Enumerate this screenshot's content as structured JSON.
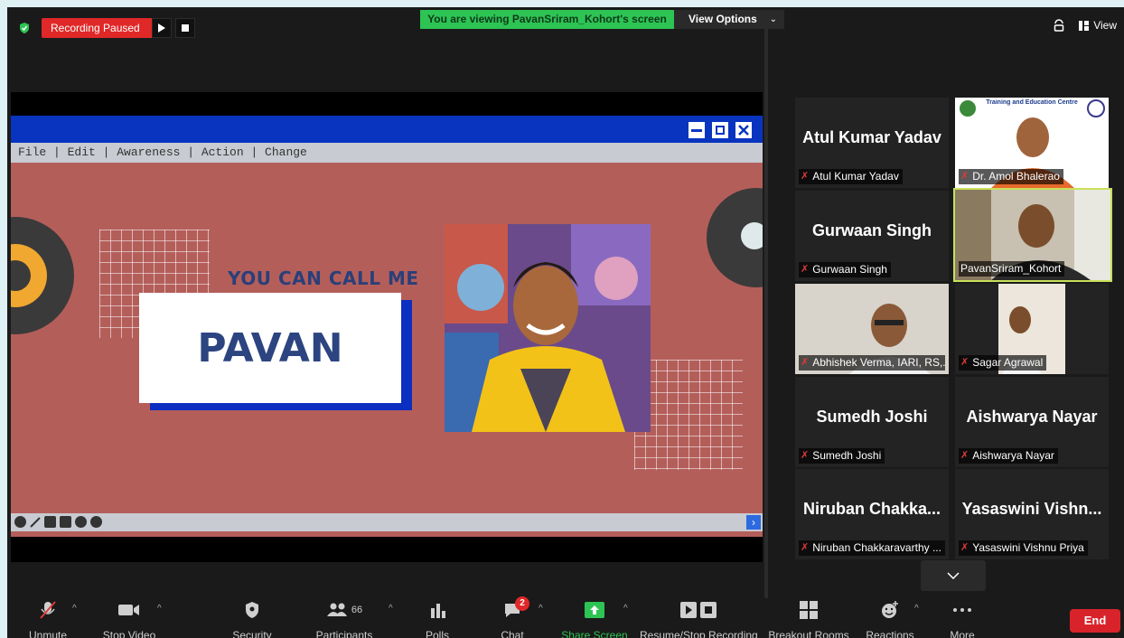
{
  "top_bar": {
    "recording_label": "Recording Paused",
    "viewing_banner": "You are viewing PavanSriram_Kohort's screen",
    "view_options_label": "View Options",
    "view_label": "View"
  },
  "slide": {
    "menu": "File | Edit | Awareness | Action | Change",
    "tagline": "YOU CAN CALL ME",
    "name": "PAVAN"
  },
  "gallery": [
    {
      "big": "Atul Kumar Yadav",
      "label": "Atul Kumar Yadav"
    },
    {
      "label": "Dr. Amol Bhalerao",
      "logo_text": "Training and Education Centre"
    },
    {
      "big": "Gurwaan Singh",
      "label": "Gurwaan Singh"
    },
    {
      "label": "PavanSriram_Kohort"
    },
    {
      "label": "Abhishek Verma, IARI, RS,..."
    },
    {
      "label": "Sagar Agrawal"
    },
    {
      "big": "Sumedh Joshi",
      "label": "Sumedh Joshi"
    },
    {
      "big": "Aishwarya Nayar",
      "label": "Aishwarya Nayar"
    },
    {
      "big": "Niruban Chakka...",
      "label": "Niruban Chakkaravarthy ..."
    },
    {
      "big": "Yasaswini Vishn...",
      "label": "Yasaswini Vishnu Priya"
    }
  ],
  "toolbar": {
    "unmute": "Unmute",
    "stop_video": "Stop Video",
    "security": "Security",
    "participants": "Participants",
    "participants_count": "66",
    "polls": "Polls",
    "chat": "Chat",
    "chat_badge": "2",
    "share_screen": "Share Screen",
    "resume_stop_recording": "Resume/Stop Recording",
    "breakout_rooms": "Breakout Rooms",
    "reactions": "Reactions",
    "more": "More",
    "end": "End"
  },
  "colors": {
    "meeting_bg": "#1a1a1a",
    "recording_red": "#e02828",
    "banner_green": "#2dc454",
    "slide_bg": "#b45e5a",
    "window_blue": "#0834c0",
    "share_green": "#2dc454",
    "end_red": "#d9232a",
    "active_speaker": "#c8e05a"
  }
}
